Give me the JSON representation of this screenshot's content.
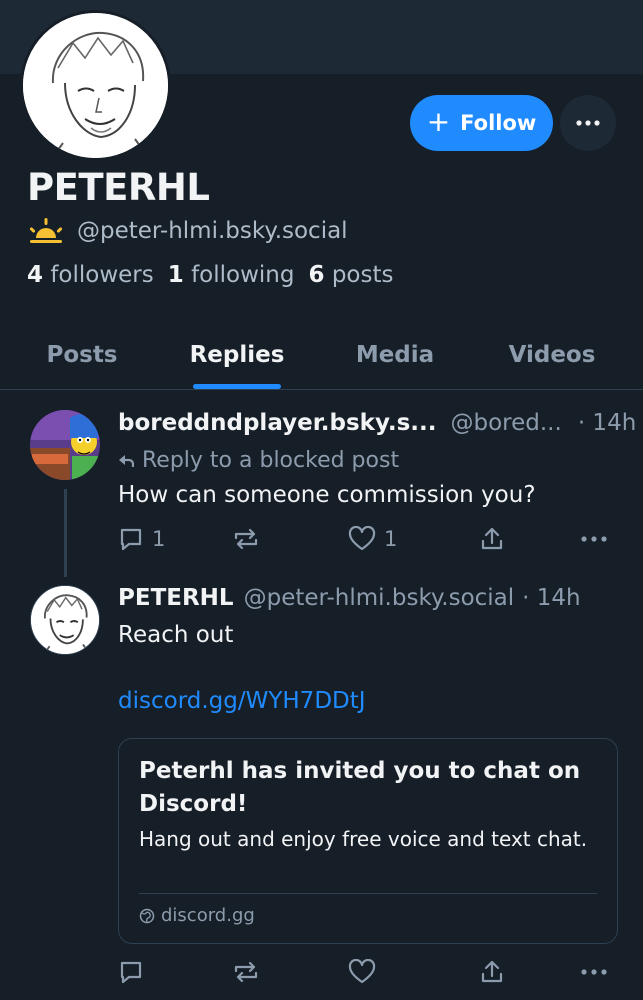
{
  "profile": {
    "display_name": "PETERHL",
    "handle": "@peter-hlmi.bsky.social",
    "followers_count": "4",
    "followers_label": "followers",
    "following_count": "1",
    "following_label": "following",
    "posts_count": "6",
    "posts_label": "posts",
    "follow_label": "Follow"
  },
  "tabs": [
    {
      "label": "Posts",
      "active": false
    },
    {
      "label": "Replies",
      "active": true
    },
    {
      "label": "Media",
      "active": false
    },
    {
      "label": "Videos",
      "active": false
    }
  ],
  "feed": {
    "parent": {
      "author_name": "boreddndplayer.bsky.s...",
      "author_handle": "@bored...",
      "time": "· 14h",
      "reply_note": "Reply to a blocked post",
      "text": "How can someone commission you?",
      "reply_count": "1",
      "like_count": "1"
    },
    "reply": {
      "author_name": "PETERHL",
      "author_handle": "@peter-hlmi.bsky.social",
      "time": "· 14h",
      "text": "Reach out",
      "link": "discord.gg/WYH7DDtJ",
      "embed": {
        "title": "Peterhl has invited you to chat on Discord!",
        "description": "Hang out and enjoy free voice and text chat.",
        "domain": "discord.gg"
      }
    }
  },
  "colors": {
    "background": "#161e27",
    "accent": "#208bfe",
    "muted_text": "#8c9cad",
    "border": "#2e4052"
  }
}
